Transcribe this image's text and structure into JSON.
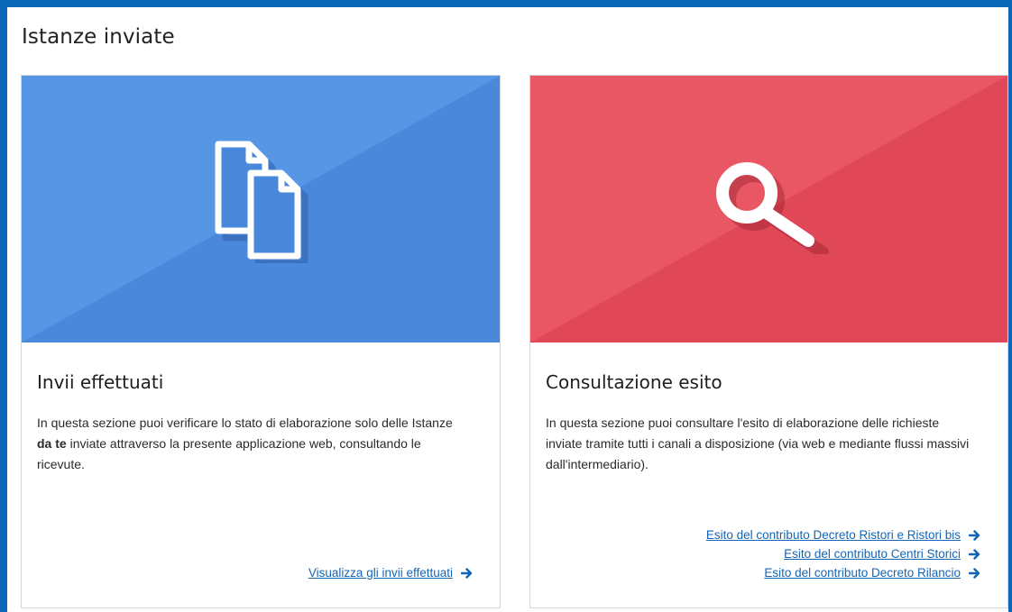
{
  "page": {
    "title": "Istanze inviate"
  },
  "colors": {
    "frame": "#0b68b8",
    "blue_card": "#4a88db",
    "red_card": "#e04757",
    "link": "#1565b5"
  },
  "cards": [
    {
      "icon": "documents-icon",
      "title": "Invii effettuati",
      "text_before": "In questa sezione puoi verificare lo stato di elaborazione solo delle Istanze ",
      "text_bold": "da te",
      "text_after": " inviate attraverso la presente applicazione web, consultando le ricevute.",
      "links": [
        {
          "label": "Visualizza gli invii effettuati"
        }
      ]
    },
    {
      "icon": "search-icon",
      "title": "Consultazione esito",
      "text": "In questa sezione puoi consultare l'esito di elaborazione delle richieste inviate tramite tutti i canali a disposizione (via web e mediante flussi massivi dall'intermediario).",
      "links": [
        {
          "label": "Esito del contributo Decreto Ristori e Ristori bis"
        },
        {
          "label": "Esito del contributo Centri Storici"
        },
        {
          "label": "Esito del contributo Decreto Rilancio"
        }
      ]
    }
  ]
}
